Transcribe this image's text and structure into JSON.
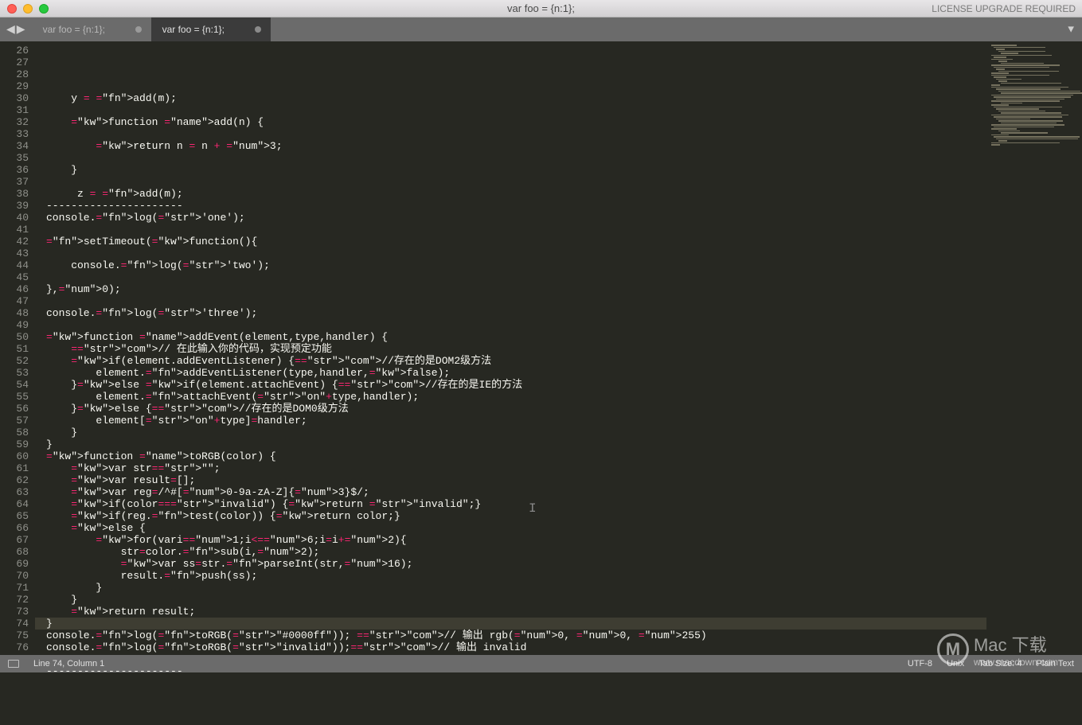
{
  "titlebar": {
    "title": "var foo = {n:1};",
    "license": "LICENSE UPGRADE REQUIRED"
  },
  "tabs": [
    {
      "label": "var foo = {n:1};",
      "active": false
    },
    {
      "label": "var foo = {n:1};",
      "active": true
    }
  ],
  "gutter": {
    "start": 26,
    "end": 76
  },
  "highlight_line": 74,
  "code_lines": [
    "",
    "    y = add(m);",
    "",
    "    function add(n) {",
    "",
    "        return n = n + 3;",
    "",
    "    }",
    "",
    "     z = add(m);",
    "----------------------",
    "console.log('one');",
    "",
    "setTimeout(function(){",
    "",
    "    console.log('two');",
    "",
    "},0);",
    "",
    "console.log('three');",
    "",
    "function addEvent(element,type,handler) {",
    "    // 在此输入你的代码，实现预定功能",
    "    if(element.addEventListener) {//存在的是DOM2级方法",
    "        element.addEventListener(type,handler,false);",
    "    }else if(element.attachEvent) {//存在的是IE的方法",
    "        element.attachEvent(\"on\"+type,handler);",
    "    }else {//存在的是DOM0级方法",
    "        element[\"on\"+type]=handler;",
    "    }",
    "}",
    "function toRGB(color) {",
    "    var str=\"\";",
    "    var result=[];",
    "    var reg=/^#[0-9a-zA-Z]{3}$/;",
    "    if(color==\"invalid\") {return \"invalid\";}",
    "    if(reg.test(color)) {return color;}",
    "    else {",
    "        for(vari=1;i<=6;i=i+2){",
    "            str=color.sub(i,2);",
    "            var ss=str.parseInt(str,16);",
    "            result.push(ss);",
    "        }",
    "    }",
    "    return result;",
    "}",
    "console.log(toRGB(\"#0000ff\")); // 输出 rgb(0, 0, 255)",
    "console.log(toRGB(\"invalid\"));// 输出 invalid",
    "",
    "----------------------",
    ""
  ],
  "statusbar": {
    "position": "Line 74, Column 1",
    "encoding": "UTF-8",
    "line_ending": "Unix",
    "tab_size": "Tab Size: 4",
    "syntax": "Plain Text"
  },
  "watermark": {
    "text": "Mac 下载",
    "url": "www.macdown.com"
  }
}
